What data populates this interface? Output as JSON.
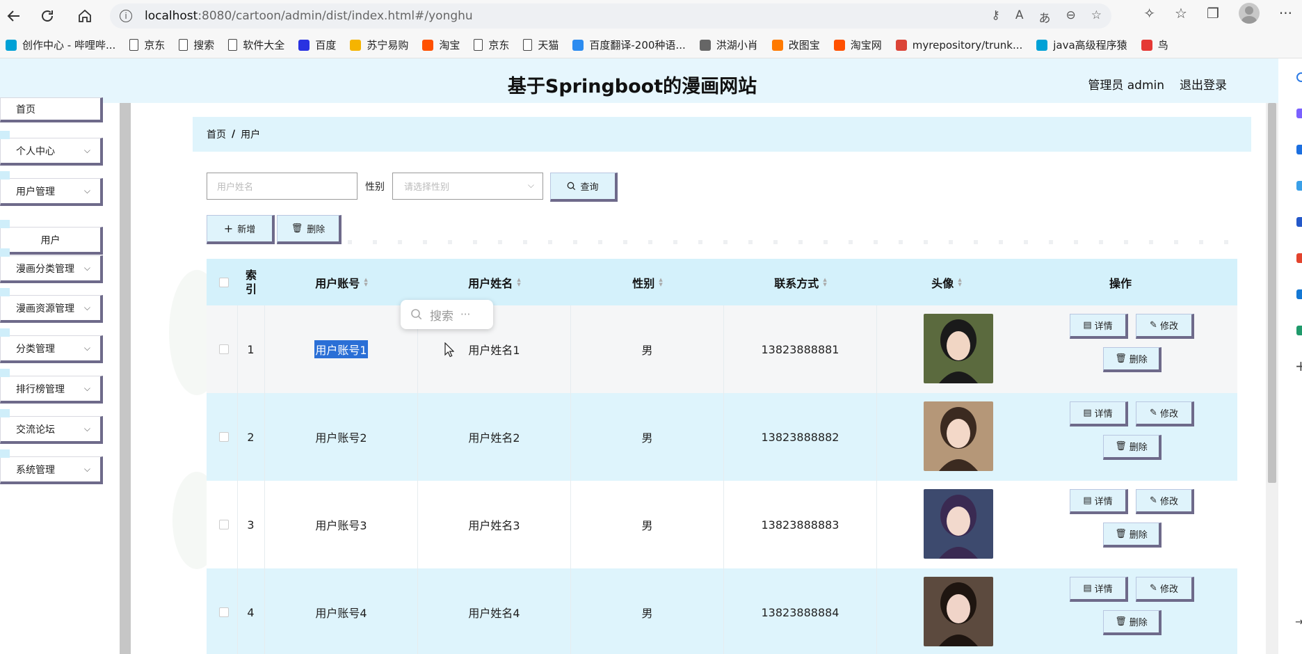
{
  "browser": {
    "url_host": "localhost",
    "url_path": ":8080/cartoon/admin/dist/index.html#/yonghu",
    "bookmarks": [
      {
        "label": "创作中心 - 哔哩哔...",
        "color": "#00a1d6"
      },
      {
        "label": "京东",
        "color": "page"
      },
      {
        "label": "搜索",
        "color": "page"
      },
      {
        "label": "软件大全",
        "color": "page"
      },
      {
        "label": "百度",
        "color": "#2932e1"
      },
      {
        "label": "苏宁易购",
        "color": "#f5b400"
      },
      {
        "label": "淘宝",
        "color": "#ff5000"
      },
      {
        "label": "京东",
        "color": "page"
      },
      {
        "label": "天猫",
        "color": "page"
      },
      {
        "label": "百度翻译-200种语...",
        "color": "#2d8cf0"
      },
      {
        "label": "洪湖小肖",
        "color": "#666"
      },
      {
        "label": "改图宝",
        "color": "#ff7a00"
      },
      {
        "label": "淘宝网",
        "color": "#ff5000"
      },
      {
        "label": "myrepository/trunk...",
        "color": "#db4437"
      },
      {
        "label": "java高级程序猿",
        "color": "#00a1d6"
      },
      {
        "label": "鸟",
        "color": "#e53935"
      }
    ]
  },
  "header": {
    "title": "基于Springboot的漫画网站",
    "admin_label": "管理员 admin",
    "logout_label": "退出登录"
  },
  "sidebar": {
    "items": [
      {
        "label": "首页",
        "chevron": false
      },
      {
        "label": "个人中心",
        "chevron": true
      },
      {
        "label": "用户管理",
        "chevron": true
      },
      {
        "label": "用户",
        "chevron": false,
        "sub": true
      },
      {
        "label": "漫画分类管理",
        "chevron": true
      },
      {
        "label": "漫画资源管理",
        "chevron": true
      },
      {
        "label": "分类管理",
        "chevron": true
      },
      {
        "label": "排行榜管理",
        "chevron": true
      },
      {
        "label": "交流论坛",
        "chevron": true
      },
      {
        "label": "系统管理",
        "chevron": true
      }
    ]
  },
  "breadcrumb": {
    "home": "首页",
    "sep": "/",
    "current": "用户"
  },
  "filters": {
    "name_placeholder": "用户姓名",
    "gender_label": "性别",
    "gender_placeholder": "请选择性别",
    "query_label": "查询",
    "add_label": "新增",
    "delete_label": "删除"
  },
  "table": {
    "headers": {
      "index": "索引",
      "account": "用户账号",
      "name": "用户姓名",
      "gender": "性别",
      "phone": "联系方式",
      "avatar": "头像",
      "actions": "操作"
    },
    "rows": [
      {
        "index": "1",
        "account": "用户账号1",
        "name": "用户姓名1",
        "gender": "男",
        "phone": "13823888881"
      },
      {
        "index": "2",
        "account": "用户账号2",
        "name": "用户姓名2",
        "gender": "男",
        "phone": "13823888882"
      },
      {
        "index": "3",
        "account": "用户账号3",
        "name": "用户姓名3",
        "gender": "男",
        "phone": "13823888883"
      },
      {
        "index": "4",
        "account": "用户账号4",
        "name": "用户姓名4",
        "gender": "男",
        "phone": "13823888884"
      }
    ],
    "action_labels": {
      "detail": "详情",
      "edit": "修改",
      "delete": "删除"
    }
  },
  "popup": {
    "search_label": "搜索",
    "more": "···"
  },
  "colors": {
    "header_bg": "#e6f6fd",
    "row_alt": "#def4fc",
    "button_shadow": "#6e6a8a",
    "selection": "#2a6fd6"
  }
}
